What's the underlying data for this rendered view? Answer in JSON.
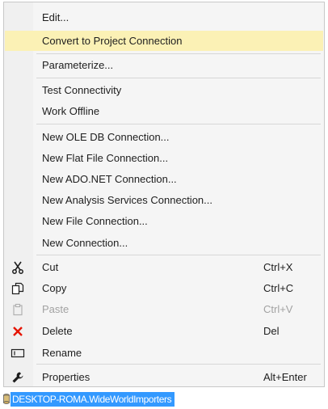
{
  "menu": {
    "items": [
      {
        "label": "Edit...",
        "shortcut": "",
        "icon": "",
        "highlighted": false,
        "disabled": false
      },
      {
        "label": "Convert to Project Connection",
        "shortcut": "",
        "icon": "",
        "highlighted": true,
        "disabled": false
      },
      {
        "label": "Parameterize...",
        "shortcut": "",
        "icon": "",
        "highlighted": false,
        "disabled": false
      },
      {
        "label": "Test Connectivity",
        "shortcut": "",
        "icon": "",
        "highlighted": false,
        "disabled": false
      },
      {
        "label": "Work Offline",
        "shortcut": "",
        "icon": "",
        "highlighted": false,
        "disabled": false
      },
      {
        "label": "New OLE DB Connection...",
        "shortcut": "",
        "icon": "",
        "highlighted": false,
        "disabled": false
      },
      {
        "label": "New Flat File Connection...",
        "shortcut": "",
        "icon": "",
        "highlighted": false,
        "disabled": false
      },
      {
        "label": "New ADO.NET Connection...",
        "shortcut": "",
        "icon": "",
        "highlighted": false,
        "disabled": false
      },
      {
        "label": "New Analysis Services Connection...",
        "shortcut": "",
        "icon": "",
        "highlighted": false,
        "disabled": false
      },
      {
        "label": "New File Connection...",
        "shortcut": "",
        "icon": "",
        "highlighted": false,
        "disabled": false
      },
      {
        "label": "New Connection...",
        "shortcut": "",
        "icon": "",
        "highlighted": false,
        "disabled": false
      },
      {
        "label": "Cut",
        "shortcut": "Ctrl+X",
        "icon": "scissors-icon",
        "highlighted": false,
        "disabled": false
      },
      {
        "label": "Copy",
        "shortcut": "Ctrl+C",
        "icon": "copy-icon",
        "highlighted": false,
        "disabled": false
      },
      {
        "label": "Paste",
        "shortcut": "Ctrl+V",
        "icon": "paste-icon",
        "highlighted": false,
        "disabled": true
      },
      {
        "label": "Delete",
        "shortcut": "Del",
        "icon": "delete-icon",
        "highlighted": false,
        "disabled": false
      },
      {
        "label": "Rename",
        "shortcut": "",
        "icon": "rename-icon",
        "highlighted": false,
        "disabled": false
      },
      {
        "label": "Properties",
        "shortcut": "Alt+Enter",
        "icon": "wrench-icon",
        "highlighted": false,
        "disabled": false
      }
    ]
  },
  "connection_node": {
    "label": "DESKTOP-ROMA.WideWorldImporters",
    "icon": "connection-icon"
  },
  "colors": {
    "highlight": "#fbf1b5",
    "selection": "#3399ff",
    "delete_red": "#e51400"
  }
}
